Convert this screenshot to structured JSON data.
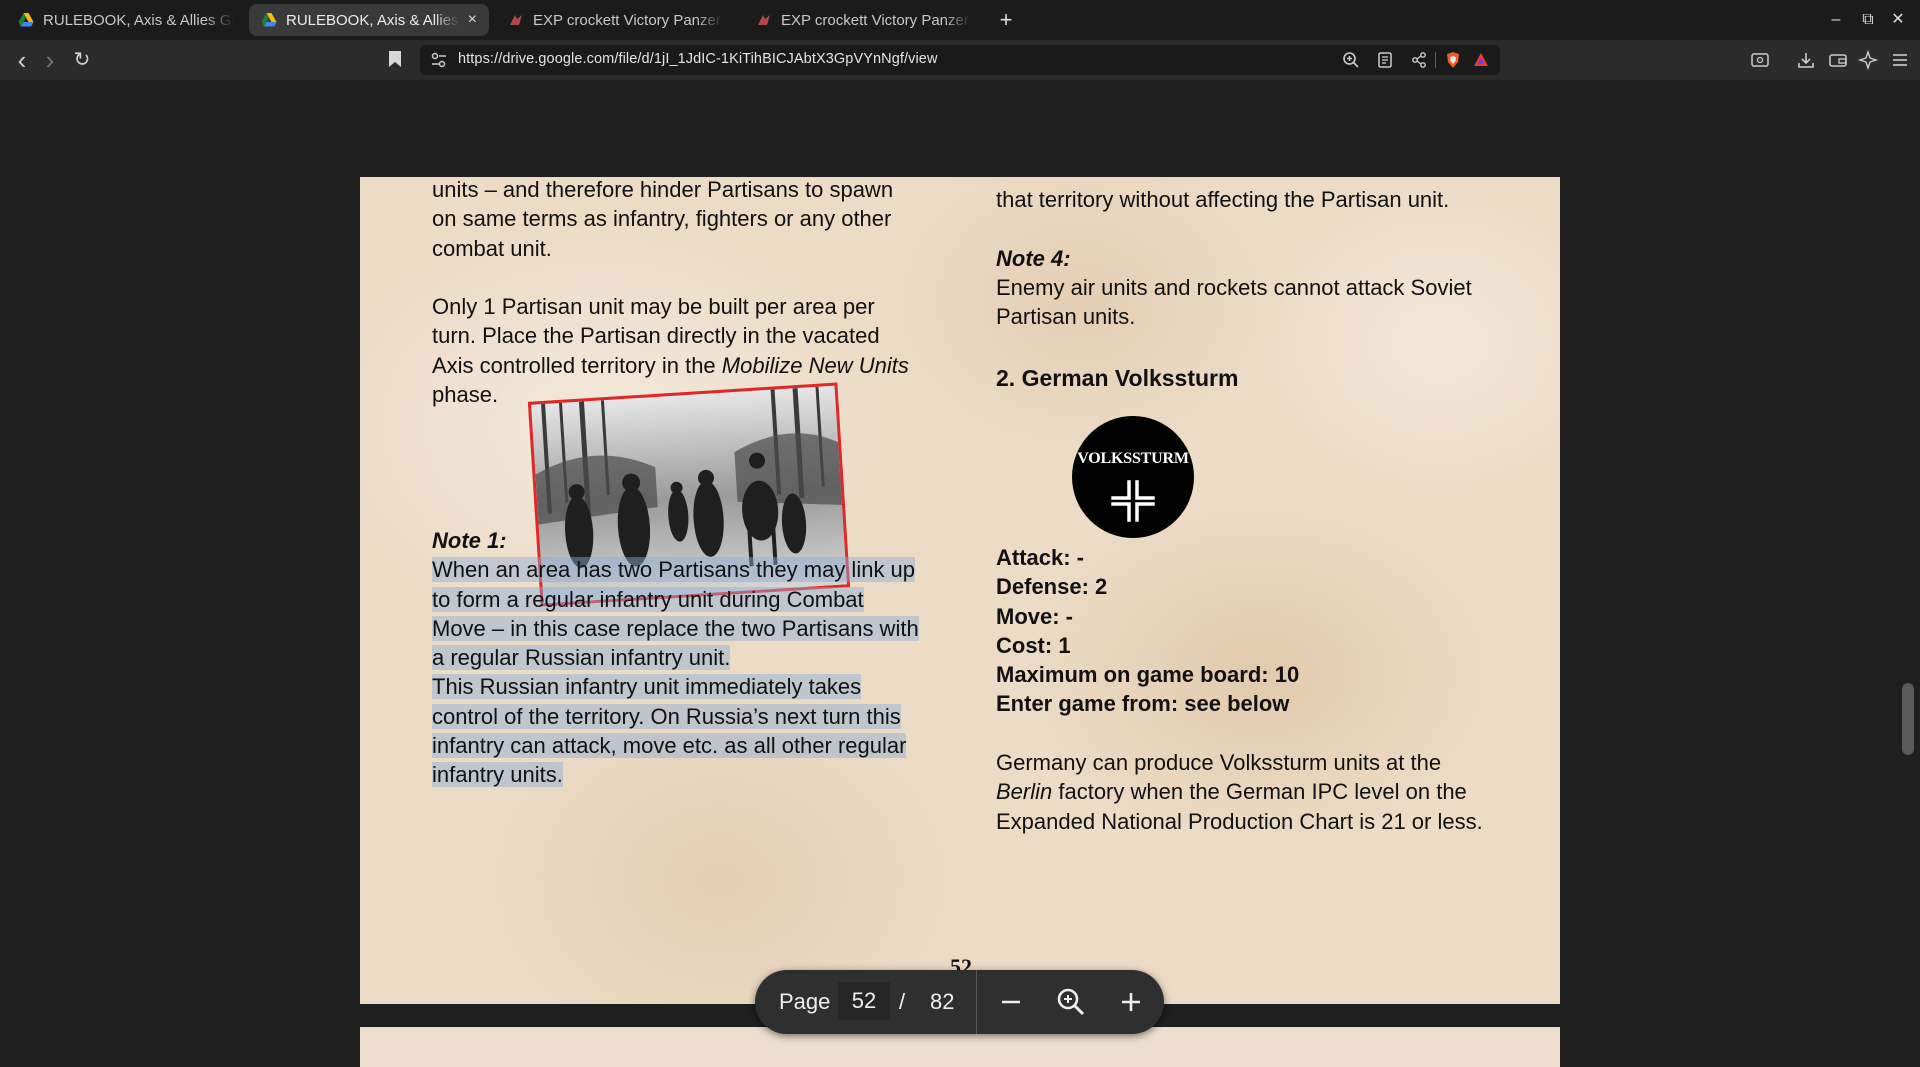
{
  "tabs": [
    {
      "title": "RULEBOOK, Axis & Allies Glo",
      "icon": "google-drive-icon",
      "active": false
    },
    {
      "title": "RULEBOOK, Axis & Allies",
      "icon": "google-drive-icon",
      "active": true,
      "close": "×"
    },
    {
      "title": "EXP crockett Victory Panzer",
      "icon": "site-icon",
      "active": false
    },
    {
      "title": "EXP crockett Victory Panzer",
      "icon": "site-icon",
      "active": false
    }
  ],
  "new_tab": "+",
  "window_controls": {
    "minimize": "–",
    "restore": "⧉",
    "close": "✕"
  },
  "nav": {
    "back": "‹",
    "forward": "›",
    "reload": "↻"
  },
  "url": "https://drive.google.com/file/d/1jI_1JdIC-1KiTihBICJAbtX3GpVYnNgf/view",
  "document": {
    "left_column": {
      "para1": [
        "units – and therefore hinder Partisans to spawn",
        "on same terms as infantry, fighters or any other",
        "combat unit."
      ],
      "para2_lines": [
        "Only 1 Partisan unit may be built per area per",
        "turn. Place the Partisan directly in the vacated"
      ],
      "para2_line3_prefix": "Axis controlled territory in the ",
      "para2_line3_italic": "Mobilize New Units",
      "para2_line4": "phase.",
      "note1_title": "Note 1:",
      "note1_lines": [
        "When an area has two Partisans they may link up",
        "to form a regular infantry unit during Combat",
        "Move – in this case replace the two Partisans with",
        "a regular Russian infantry unit.",
        "This Russian infantry unit immediately takes",
        "control of the territory. On Russia’s next turn this",
        "infantry can attack, move etc. as all other regular",
        "infantry units."
      ]
    },
    "right_column": {
      "top_line": "that territory without affecting the Partisan unit.",
      "note4_title": "Note 4:",
      "note4_lines": [
        "Enemy air units and rockets cannot attack Soviet",
        "Partisan units."
      ],
      "section_title": "2. German Volkssturm",
      "badge_text": "VOLKSSTURM",
      "stats": [
        "Attack: -",
        "Defense: 2",
        "Move: -",
        "Cost: 1",
        "Maximum on game board: 10",
        "Enter game from: see below"
      ],
      "body_line1": "Germany can produce Volkssturm units at the",
      "body_line2_italic": "Berlin",
      "body_line2_rest": " factory when the German IPC level on the",
      "body_line3": "Expanded National Production Chart is 21 or less."
    },
    "page_number": "52"
  },
  "pager": {
    "label": "Page",
    "current": "52",
    "separator": "/",
    "total": "82"
  }
}
